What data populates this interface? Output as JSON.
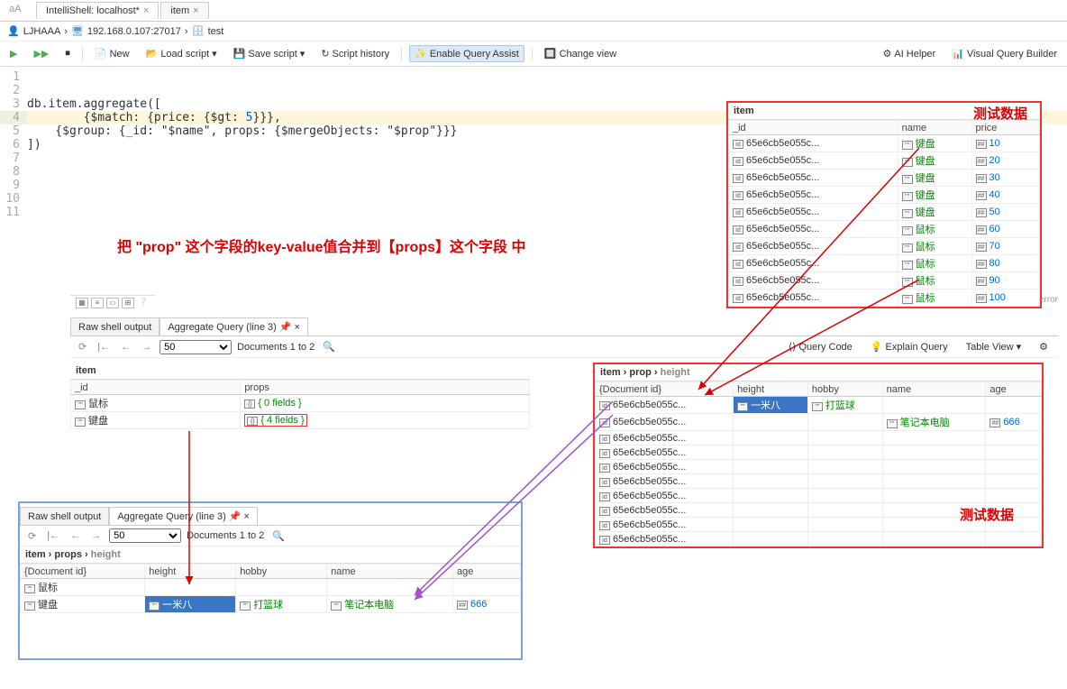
{
  "tabs": [
    {
      "label": "IntelliShell: localhost*",
      "closable": true,
      "active": true
    },
    {
      "label": "item",
      "closable": true,
      "active": false
    }
  ],
  "aA_label": "aA",
  "breadcrumb": {
    "user": "LJHAAA",
    "host": "192.168.0.107:27017",
    "db": "test"
  },
  "toolbar": {
    "new": "New",
    "load_script": "Load script",
    "save_script": "Save script",
    "script_history": "Script history",
    "enable_query_assist": "Enable Query Assist",
    "change_view": "Change view",
    "ai_helper": "AI Helper",
    "visual_query_builder": "Visual Query Builder"
  },
  "code_lines": [
    {
      "n": "1",
      "t": ""
    },
    {
      "n": "2",
      "t": ""
    },
    {
      "n": "3",
      "t": "db.item.aggregate(["
    },
    {
      "n": "4",
      "t": "        {$match: {price: {$gt: 5}}},",
      "hl": true
    },
    {
      "n": "5",
      "t": "    {$group: {_id: \"$name\", props: {$mergeObjects: \"$prop\"}}}"
    },
    {
      "n": "6",
      "t": "])"
    },
    {
      "n": "7",
      "t": ""
    },
    {
      "n": "8",
      "t": ""
    },
    {
      "n": "9",
      "t": ""
    },
    {
      "n": "10",
      "t": ""
    },
    {
      "n": "11",
      "t": ""
    }
  ],
  "annotation_main": "把 \"prop\" 这个字段的key-value值合并到【props】这个字段 中",
  "annotation_test_data": "测试数据",
  "no_errors": "No error",
  "item_panel": {
    "title": "item",
    "cols": [
      "_id",
      "name",
      "price"
    ],
    "rows": [
      {
        "id": "65e6cb5e055c...",
        "name": "键盘",
        "price": "10"
      },
      {
        "id": "65e6cb5e055c...",
        "name": "键盘",
        "price": "20"
      },
      {
        "id": "65e6cb5e055c...",
        "name": "键盘",
        "price": "30"
      },
      {
        "id": "65e6cb5e055c...",
        "name": "键盘",
        "price": "40"
      },
      {
        "id": "65e6cb5e055c...",
        "name": "键盘",
        "price": "50"
      },
      {
        "id": "65e6cb5e055c...",
        "name": "鼠标",
        "price": "60"
      },
      {
        "id": "65e6cb5e055c...",
        "name": "鼠标",
        "price": "70"
      },
      {
        "id": "65e6cb5e055c...",
        "name": "鼠标",
        "price": "80"
      },
      {
        "id": "65e6cb5e055c...",
        "name": "鼠标",
        "price": "90"
      },
      {
        "id": "65e6cb5e055c...",
        "name": "鼠标",
        "price": "100"
      }
    ]
  },
  "result_tabs": {
    "raw": "Raw shell output",
    "agg": "Aggregate Query (line 3)",
    "page_size": "50",
    "doc_range": "Documents 1 to 2",
    "query_code": "Query Code",
    "explain_query": "Explain Query",
    "table_view": "Table View"
  },
  "result1": {
    "title": "item",
    "cols": [
      "_id",
      "props"
    ],
    "rows": [
      {
        "id": "鼠标",
        "props": "{ 0 fields }"
      },
      {
        "id": "键盘",
        "props": "{ 4 fields }",
        "box": true
      }
    ]
  },
  "prop_panel": {
    "breadcrumb": [
      "item",
      "prop",
      "height"
    ],
    "cols": [
      "{Document id}",
      "height",
      "hobby",
      "name",
      "age"
    ],
    "rows": [
      {
        "id": "65e6cb5e055c...",
        "height": "一米八",
        "hobby": "打篮球",
        "name": "",
        "age": "",
        "sel": true
      },
      {
        "id": "65e6cb5e055c...",
        "height": "",
        "hobby": "",
        "name": "笔记本电脑",
        "age": "666"
      },
      {
        "id": "65e6cb5e055c..."
      },
      {
        "id": "65e6cb5e055c..."
      },
      {
        "id": "65e6cb5e055c..."
      },
      {
        "id": "65e6cb5e055c..."
      },
      {
        "id": "65e6cb5e055c..."
      },
      {
        "id": "65e6cb5e055c..."
      },
      {
        "id": "65e6cb5e055c..."
      },
      {
        "id": "65e6cb5e055c..."
      }
    ]
  },
  "result2": {
    "breadcrumb": [
      "item",
      "props",
      "height"
    ],
    "cols": [
      "{Document id}",
      "height",
      "hobby",
      "name",
      "age"
    ],
    "rows": [
      {
        "id": "鼠标",
        "height": "",
        "hobby": "",
        "name": "",
        "age": ""
      },
      {
        "id": "键盘",
        "height": "一米八",
        "hobby": "打篮球",
        "name": "笔记本电脑",
        "age": "666",
        "sel": true
      }
    ]
  }
}
